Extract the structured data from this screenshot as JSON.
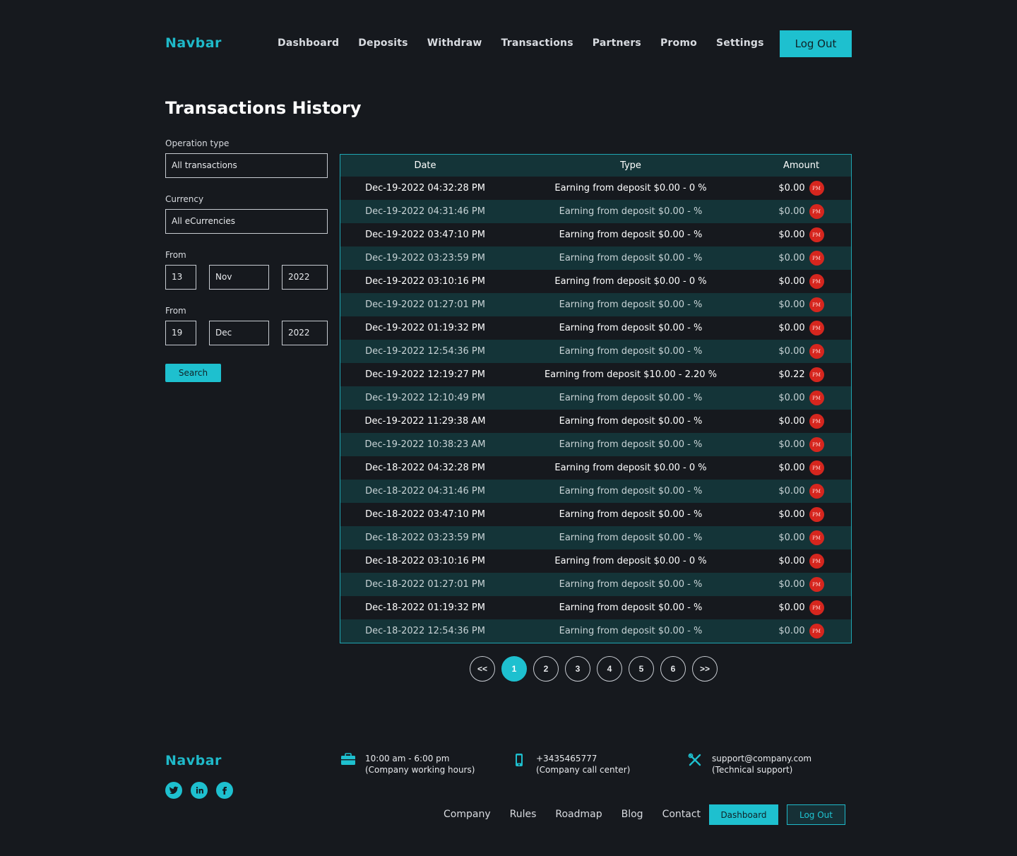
{
  "nav": {
    "brand": "Navbar",
    "links": [
      "Dashboard",
      "Deposits",
      "Withdraw",
      "Transactions",
      "Partners",
      "Promo",
      "Settings"
    ],
    "logout": "Log Out"
  },
  "page": {
    "title": "Transactions History"
  },
  "filters": {
    "operation_label": "Operation type",
    "operation_value": "All transactions",
    "currency_label": "Currency",
    "currency_value": "All eCurrencies",
    "from_label": "From",
    "from_day": "13",
    "from_month": "Nov",
    "from_year": "2022",
    "to_label": "From",
    "to_day": "19",
    "to_month": "Dec",
    "to_year": "2022",
    "search": "Search"
  },
  "table": {
    "headers": [
      "Date",
      "Type",
      "Amount"
    ],
    "badge": "PM",
    "rows": [
      {
        "date": "Dec-19-2022 04:32:28 PM",
        "type": "Earning from deposit $0.00 - 0 %",
        "amount": "$0.00"
      },
      {
        "date": "Dec-19-2022 04:31:46 PM",
        "type": "Earning from deposit $0.00 - %",
        "amount": "$0.00"
      },
      {
        "date": "Dec-19-2022 03:47:10 PM",
        "type": "Earning from deposit $0.00 - %",
        "amount": "$0.00"
      },
      {
        "date": "Dec-19-2022 03:23:59 PM",
        "type": "Earning from deposit $0.00 - %",
        "amount": "$0.00"
      },
      {
        "date": "Dec-19-2022 03:10:16 PM",
        "type": "Earning from deposit $0.00 - 0 %",
        "amount": "$0.00"
      },
      {
        "date": "Dec-19-2022 01:27:01 PM",
        "type": "Earning from deposit $0.00 - %",
        "amount": "$0.00"
      },
      {
        "date": "Dec-19-2022 01:19:32 PM",
        "type": "Earning from deposit $0.00 - %",
        "amount": "$0.00"
      },
      {
        "date": "Dec-19-2022 12:54:36 PM",
        "type": "Earning from deposit $0.00 - %",
        "amount": "$0.00"
      },
      {
        "date": "Dec-19-2022 12:19:27 PM",
        "type": "Earning from deposit $10.00 - 2.20 %",
        "amount": "$0.22"
      },
      {
        "date": "Dec-19-2022 12:10:49 PM",
        "type": "Earning from deposit $0.00 - %",
        "amount": "$0.00"
      },
      {
        "date": "Dec-19-2022 11:29:38 AM",
        "type": "Earning from deposit $0.00 - %",
        "amount": "$0.00"
      },
      {
        "date": "Dec-19-2022 10:38:23 AM",
        "type": "Earning from deposit $0.00 - %",
        "amount": "$0.00"
      },
      {
        "date": "Dec-18-2022 04:32:28 PM",
        "type": "Earning from deposit $0.00 - 0 %",
        "amount": "$0.00"
      },
      {
        "date": "Dec-18-2022 04:31:46 PM",
        "type": "Earning from deposit $0.00 - %",
        "amount": "$0.00"
      },
      {
        "date": "Dec-18-2022 03:47:10 PM",
        "type": "Earning from deposit $0.00 - %",
        "amount": "$0.00"
      },
      {
        "date": "Dec-18-2022 03:23:59 PM",
        "type": "Earning from deposit $0.00 - %",
        "amount": "$0.00"
      },
      {
        "date": "Dec-18-2022 03:10:16 PM",
        "type": "Earning from deposit $0.00 - 0 %",
        "amount": "$0.00"
      },
      {
        "date": "Dec-18-2022 01:27:01 PM",
        "type": "Earning from deposit $0.00 - %",
        "amount": "$0.00"
      },
      {
        "date": "Dec-18-2022 01:19:32 PM",
        "type": "Earning from deposit $0.00 - %",
        "amount": "$0.00"
      },
      {
        "date": "Dec-18-2022 12:54:36 PM",
        "type": "Earning from deposit $0.00 - %",
        "amount": "$0.00"
      }
    ]
  },
  "pagination": {
    "prev": "<<",
    "pages": [
      "1",
      "2",
      "3",
      "4",
      "5",
      "6"
    ],
    "active": "1",
    "next": ">>"
  },
  "footer": {
    "brand": "Navbar",
    "socials": [
      "twitter-icon",
      "linkedin-icon",
      "facebook-icon"
    ],
    "hours_line1": "10:00 am - 6:00 pm",
    "hours_line2": "(Company working hours)",
    "phone_line1": "+3435465777",
    "phone_line2": "(Company call center)",
    "support_line1": "support@company.com",
    "support_line2": "(Technical support)",
    "links": [
      "Company",
      "Rules",
      "Roadmap",
      "Blog",
      "Contact"
    ],
    "dashboard": "Dashboard",
    "logout": "Log Out"
  },
  "colors": {
    "accent": "#1ec0cf",
    "background": "#16191e",
    "row_alt": "#143438",
    "badge": "#d6261e"
  }
}
